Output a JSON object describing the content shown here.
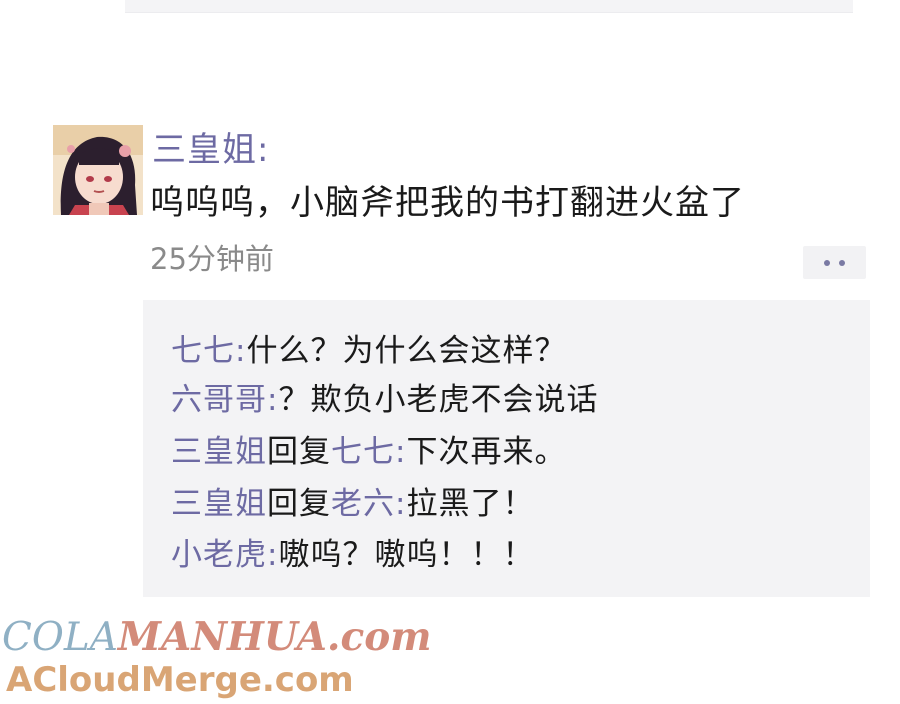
{
  "post": {
    "username": "三皇姐:",
    "text": "呜呜呜，小脑斧把我的书打翻进火盆了",
    "timestamp": "25分钟前"
  },
  "comments": [
    {
      "name": "七七:",
      "text": "什么？为什么会这样？"
    },
    {
      "name": "六哥哥:",
      "text": "？欺负小老虎不会说话"
    },
    {
      "name": "三皇姐",
      "reply_word": "回复",
      "reply_to": "七七:",
      "text": "下次再来。"
    },
    {
      "name": "三皇姐",
      "reply_word": "回复",
      "reply_to": "老六:",
      "text": "拉黑了！"
    },
    {
      "name": "小老虎:",
      "text": "嗷呜？嗷呜！！！"
    }
  ],
  "watermark": {
    "part1": "COLA",
    "part2": "MANHUA.com",
    "line2": "ACloudMerge.com"
  },
  "icons": {
    "more": "more-dots-icon",
    "avatar": "anime-girl-avatar"
  },
  "colors": {
    "name_accent": "#6d6aa3",
    "text": "#1a1a1a",
    "timestamp": "#8a8a8a",
    "comment_bg": "#f3f3f5"
  }
}
